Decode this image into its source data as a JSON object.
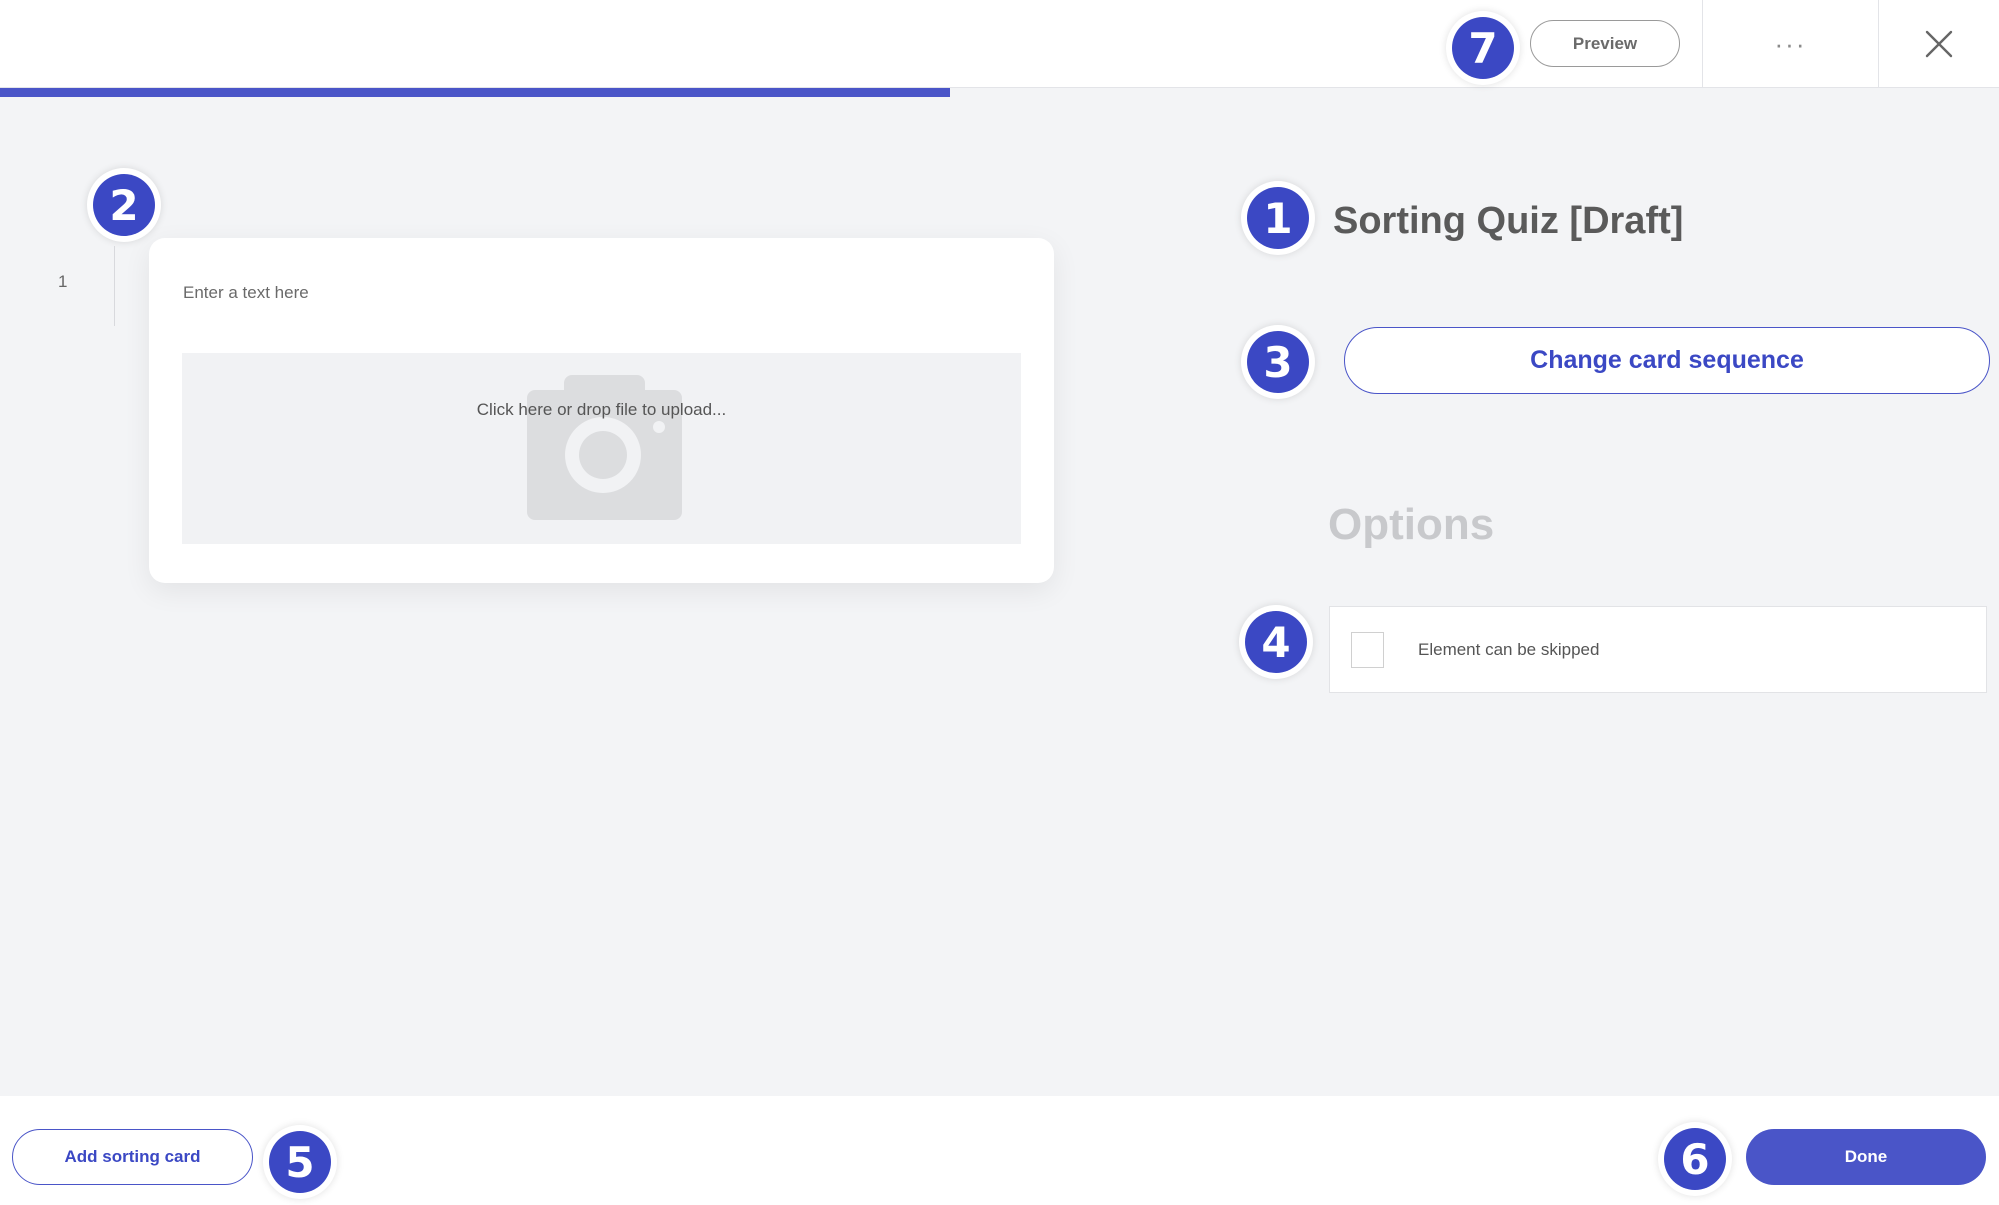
{
  "header": {
    "preview_label": "Preview",
    "more_label": "···",
    "progress_fraction": 0.475
  },
  "markers": {
    "m1": "1",
    "m2": "2",
    "m3": "3",
    "m4": "4",
    "m5": "5",
    "m6": "6",
    "m7": "7"
  },
  "editor": {
    "row_number": "1",
    "card_text_placeholder": "Enter a text here",
    "upload_text": "Click here or drop file to upload..."
  },
  "panel": {
    "title": "Sorting Quiz [Draft]",
    "change_sequence_label": "Change card sequence",
    "options_heading": "Options",
    "skip_label": "Element can be skipped",
    "skip_checked": false
  },
  "footer": {
    "add_card_label": "Add sorting card",
    "done_label": "Done"
  },
  "colors": {
    "accent": "#3b48c4",
    "progress": "#4a55c8",
    "background": "#f3f4f6"
  },
  "icons": [
    "more-icon",
    "close-icon",
    "camera-icon"
  ]
}
